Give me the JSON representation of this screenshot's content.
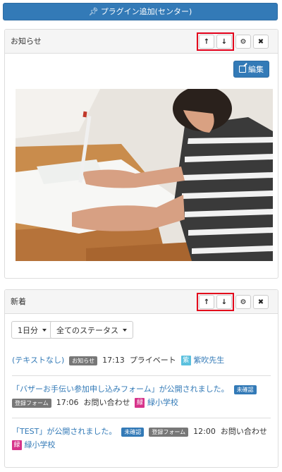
{
  "add_plugin": {
    "label": "プラグイン追加(センター)"
  },
  "panel1": {
    "title": "お知らせ",
    "edit_label": "編集"
  },
  "panel2": {
    "title": "新着",
    "period_label": "1日分",
    "status_label": "全てのステータス",
    "entries": [
      {
        "title": "(テキストなし)",
        "badge": "お知らせ",
        "time": "17:13",
        "category": "プライベート",
        "author_initial": "紫",
        "author": "紫吹先生"
      },
      {
        "title": "「バザーお手伝い参加申し込みフォーム」が公開されました。",
        "badge": "未確認",
        "form_badge": "登録フォーム",
        "time": "17:06",
        "category": "お問い合わせ",
        "author_initial": "緑",
        "author": "緑小学校"
      },
      {
        "title": "「TEST」が公開されました。",
        "badge": "未確認",
        "form_badge": "登録フォーム",
        "time": "12:00",
        "category": "お問い合わせ",
        "author_initial": "緑",
        "author": "緑小学校"
      }
    ]
  },
  "colors": {
    "primary": "#337ab7",
    "highlight": "#e3001b",
    "avatar_teal": "#5bc0de",
    "avatar_pink": "#d6338a"
  }
}
